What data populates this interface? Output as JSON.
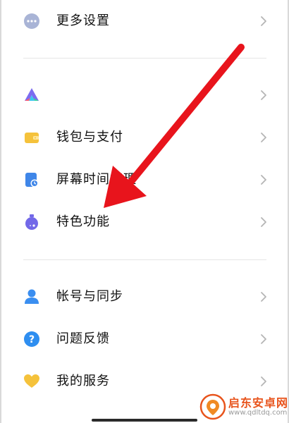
{
  "settings": {
    "more_settings": "更多设置",
    "item2": "",
    "wallet_pay": "钱包与支付",
    "screen_time": "屏幕时间管理",
    "special_features": "特色功能",
    "account_sync": "帐号与同步",
    "help_feedback": "问题反馈",
    "my_services": "我的服务"
  },
  "watermark": {
    "title": "启东安卓网",
    "url": "www.qdltdq.com"
  },
  "colors": {
    "arrow": "#e8141c",
    "icon_gray": "#a9b4d6",
    "wallet": "#f5c23b",
    "screen_time": "#3f86e8",
    "special": "#7268e8",
    "account": "#3a8ef0",
    "help": "#2e8ef0",
    "services": "#f5c23b"
  },
  "icons": {
    "more_settings": "dots-circle-icon",
    "item2": "triangle-colorful-icon",
    "wallet": "wallet-icon",
    "screen_time": "hourglass-phone-icon",
    "special": "potion-icon",
    "account": "person-icon",
    "help": "question-icon",
    "services": "heart-icon",
    "chevron": "chevron-right-icon"
  }
}
